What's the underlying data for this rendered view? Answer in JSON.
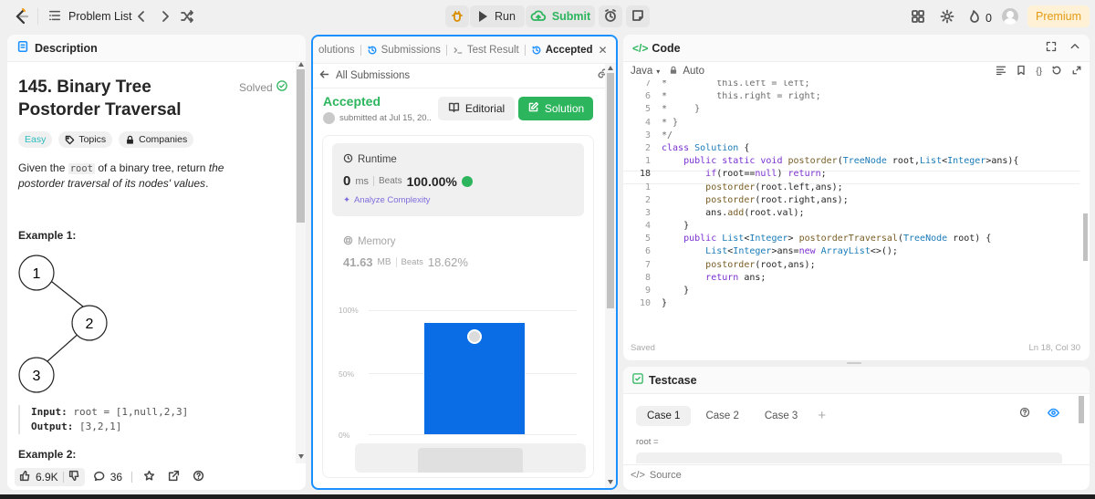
{
  "topbar": {
    "problem_list": "Problem List",
    "run": "Run",
    "submit": "Submit",
    "streak": "0",
    "premium": "Premium"
  },
  "description": {
    "tab": "Description",
    "title": "145. Binary Tree Postorder Traversal",
    "solved": "Solved",
    "difficulty": "Easy",
    "topics": "Topics",
    "companies": "Companies",
    "text_pre": "Given the ",
    "text_code": "root",
    "text_mid": " of a binary tree, return ",
    "text_em": "the postorder traversal of its nodes' values",
    "text_end": ".",
    "example1": "Example 1:",
    "tree_nodes": [
      "1",
      "2",
      "3"
    ],
    "input_label": "Input:",
    "input_value": "root = [1,null,2,3]",
    "output_label": "Output:",
    "output_value": "[3,2,1]",
    "example2": "Example 2:",
    "likes": "6.9K",
    "comments": "36"
  },
  "submission": {
    "tabs": [
      "olutions",
      "Submissions",
      "Test Result",
      "Accepted"
    ],
    "back": "All Submissions",
    "status": "Accepted",
    "submitted": "submitted at Jul 15, 20..",
    "editorial": "Editorial",
    "solution": "Solution",
    "runtime_label": "Runtime",
    "runtime_value": "0",
    "runtime_unit": "ms",
    "beats_label": "Beats",
    "runtime_beats": "100.00%",
    "analyze": "Analyze Complexity",
    "memory_label": "Memory",
    "memory_value": "41.63",
    "memory_unit": "MB",
    "memory_beats": "18.62%",
    "chart_ticks": [
      "100%",
      "50%",
      "0%"
    ],
    "bar_fraction": 1.0
  },
  "code": {
    "tab": "Code",
    "language": "Java",
    "mode": "Auto",
    "saved": "Saved",
    "position": "Ln 18, Col 30",
    "line_numbers": [
      "7",
      "6",
      "5",
      "4",
      "3",
      "2",
      "1",
      "18",
      "1",
      "2",
      "3",
      "4",
      "5",
      "6",
      "7",
      "8",
      "9",
      "10"
    ]
  },
  "testcase": {
    "tab": "Testcase",
    "cases": [
      "Case 1",
      "Case 2",
      "Case 3"
    ],
    "param": "root =",
    "source": "Source"
  },
  "colors": {
    "accent_green": "#2db55d",
    "accent_blue": "#1a90ff",
    "bar_blue": "#0a6de6",
    "premium_bg": "#fff1d6",
    "premium_text": "#e39b14"
  }
}
